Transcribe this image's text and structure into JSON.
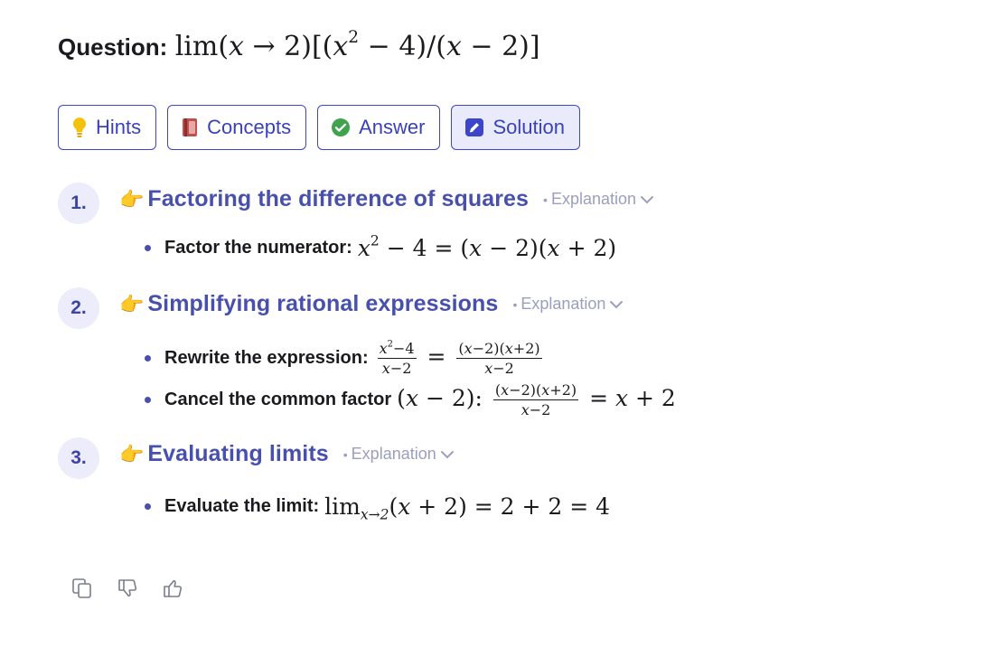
{
  "question": {
    "label": "Question:",
    "math_prefix": "lim",
    "math_body": "(x → 2)[(x² − 4)/(x − 2)]"
  },
  "tabs": [
    {
      "label": "Hints",
      "icon": "lightbulb-icon",
      "color": "#f4c20d"
    },
    {
      "label": "Concepts",
      "icon": "book-icon",
      "color": "#c0504d"
    },
    {
      "label": "Answer",
      "icon": "check-circle-icon",
      "color": "#3fa34d"
    },
    {
      "label": "Solution",
      "icon": "pencil-square-icon",
      "color": "#3d46c9",
      "active": true
    }
  ],
  "explanation_label": "Explanation",
  "steps": [
    {
      "number": "1.",
      "title": "Factoring the difference of squares",
      "bullets": [
        {
          "text": "Factor the numerator:",
          "math": "x² − 4 = (x − 2)(x + 2)"
        }
      ]
    },
    {
      "number": "2.",
      "title": "Simplifying rational expressions",
      "bullets": [
        {
          "text": "Rewrite the expression:",
          "math": "(x² − 4)/(x − 2) = (x − 2)(x + 2)/(x − 2)"
        },
        {
          "text": "Cancel the common factor",
          "math": "(x − 2): (x − 2)(x + 2)/(x − 2) = x + 2"
        }
      ]
    },
    {
      "number": "3.",
      "title": "Evaluating limits",
      "bullets": [
        {
          "text": "Evaluate the limit:",
          "math": "lim x→2 (x + 2) = 2 + 2 = 4"
        }
      ]
    }
  ],
  "feedback": {
    "icons": [
      "copy-icon",
      "thumbs-down-icon",
      "thumbs-up-icon"
    ]
  },
  "colors": {
    "accent": "#3d46c9",
    "step_title": "#4850ad",
    "step_badge_bg": "#ececfa",
    "explanation_text": "#9a9fbf"
  }
}
